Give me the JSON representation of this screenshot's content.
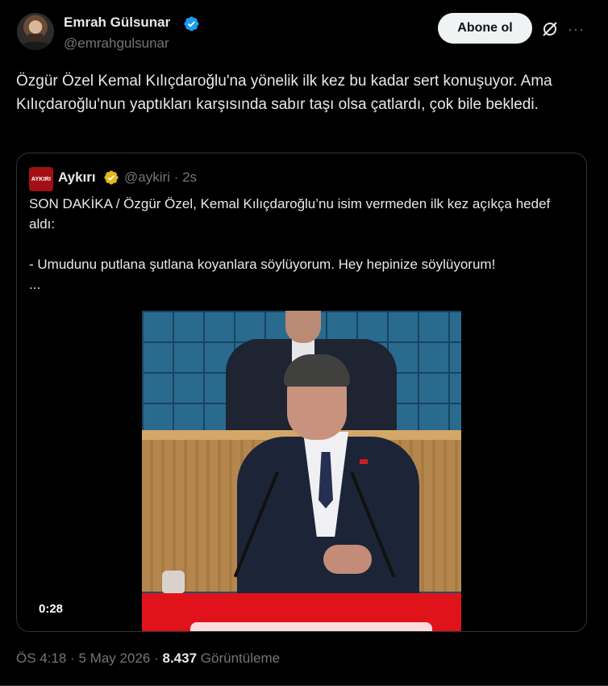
{
  "author": {
    "name": "Emrah Gülsunar",
    "handle": "@emrahgulsunar",
    "verified_color": "#1d9bf0"
  },
  "actions": {
    "follow_label": "Abone ol",
    "grok_icon": "grok-slash-icon",
    "more_icon": "more-icon",
    "more_glyph": "···"
  },
  "tweet": {
    "text": "Özgür Özel Kemal Kılıçdaroğlu'na yönelik ilk kez bu kadar sert konuşuyor. Ama Kılıçdaroğlu'nun yaptıkları karşısında sabır taşı olsa çatlardı, çok bile bekledi."
  },
  "quote": {
    "avatar_text": "AYKIRI",
    "name": "Aykırı",
    "handle": "@aykiri",
    "separator": "·",
    "time": "2s",
    "badge_color": "#e2b719",
    "text": "SON DAKİKA / Özgür Özel, Kemal Kılıçdaroğlu’nu isim vermeden ilk kez açıkça hedef aldı:\n\n- Umudunu putlana şutlana koyanlara söylüyorum. Hey hepinize söylüyorum!\n...",
    "video": {
      "duration": "0:28"
    }
  },
  "meta": {
    "time": "ÖS 4:18",
    "sep1": "·",
    "date": "5 May 2026",
    "sep2": "·",
    "views": "8.437",
    "views_label": "Görüntüleme"
  }
}
